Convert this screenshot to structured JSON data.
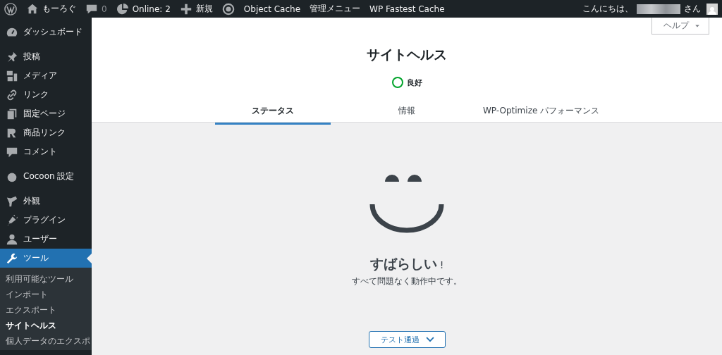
{
  "admin_bar": {
    "site_name": "もーろぐ",
    "comments": "0",
    "online": "Online: 2",
    "new": "新規",
    "menu_items": [
      "Object Cache",
      "管理メニュー",
      "WP Fastest Cache"
    ],
    "greeting": "こんにちは、",
    "greeting_suffix": "さん"
  },
  "sidebar": {
    "groups": [
      [
        {
          "label": "ダッシュボード",
          "selected": false
        }
      ],
      [
        {
          "label": "投稿",
          "selected": false
        },
        {
          "label": "メディア",
          "selected": false
        },
        {
          "label": "リンク",
          "selected": false
        },
        {
          "label": "固定ページ",
          "selected": false
        },
        {
          "label": "商品リンク",
          "selected": false
        },
        {
          "label": "コメント",
          "selected": false
        }
      ],
      [
        {
          "label": "Cocoon 設定",
          "selected": false
        }
      ],
      [
        {
          "label": "外観",
          "selected": false
        },
        {
          "label": "プラグイン",
          "selected": false
        },
        {
          "label": "ユーザー",
          "selected": false
        },
        {
          "label": "ツール",
          "selected": true,
          "children": [
            {
              "label": "利用可能なツール",
              "selected": false
            },
            {
              "label": "インポート",
              "selected": false
            },
            {
              "label": "エクスポート",
              "selected": false
            },
            {
              "label": "サイトヘルス",
              "selected": true
            },
            {
              "label": "個人データのエクスポ",
              "selected": false
            }
          ]
        }
      ]
    ]
  },
  "help_button": "ヘルプ",
  "page": {
    "title": "サイトヘルス",
    "status": "良好",
    "tabs": [
      {
        "label": "ステータス",
        "selected": true
      },
      {
        "label": "情報",
        "selected": false
      },
      {
        "label": "WP-Optimize パフォーマンス",
        "selected": false
      }
    ]
  },
  "result": {
    "heading": "すばらしい",
    "exclaim": "!",
    "message": "すべて問題なく動作中です。",
    "button": "テスト通過"
  }
}
